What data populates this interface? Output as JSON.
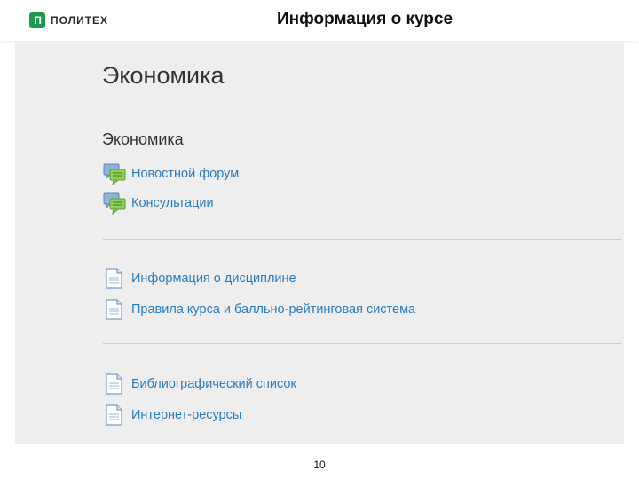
{
  "header": {
    "logo_text": "ПОЛИТЕХ",
    "logo_mark": "П",
    "slide_title": "Информация о курсе"
  },
  "course": {
    "title": "Экономика",
    "section_title": "Экономика",
    "groups": [
      [
        {
          "label": "Новостной форум",
          "icon": "forum-icon"
        },
        {
          "label": "Консультации",
          "icon": "forum-icon"
        }
      ],
      [
        {
          "label": "Информация о дисциплине",
          "icon": "page-icon"
        },
        {
          "label": "Правила курса и балльно-рейтинговая система",
          "icon": "page-icon"
        }
      ],
      [
        {
          "label": "Библиографический список",
          "icon": "page-icon"
        },
        {
          "label": "Интернет-ресурсы",
          "icon": "page-icon"
        }
      ]
    ]
  },
  "footer": {
    "page_number": "10"
  },
  "colors": {
    "link": "#2a7cc0",
    "brand_green": "#1f9b4f",
    "content_bg": "#eeeeee"
  }
}
